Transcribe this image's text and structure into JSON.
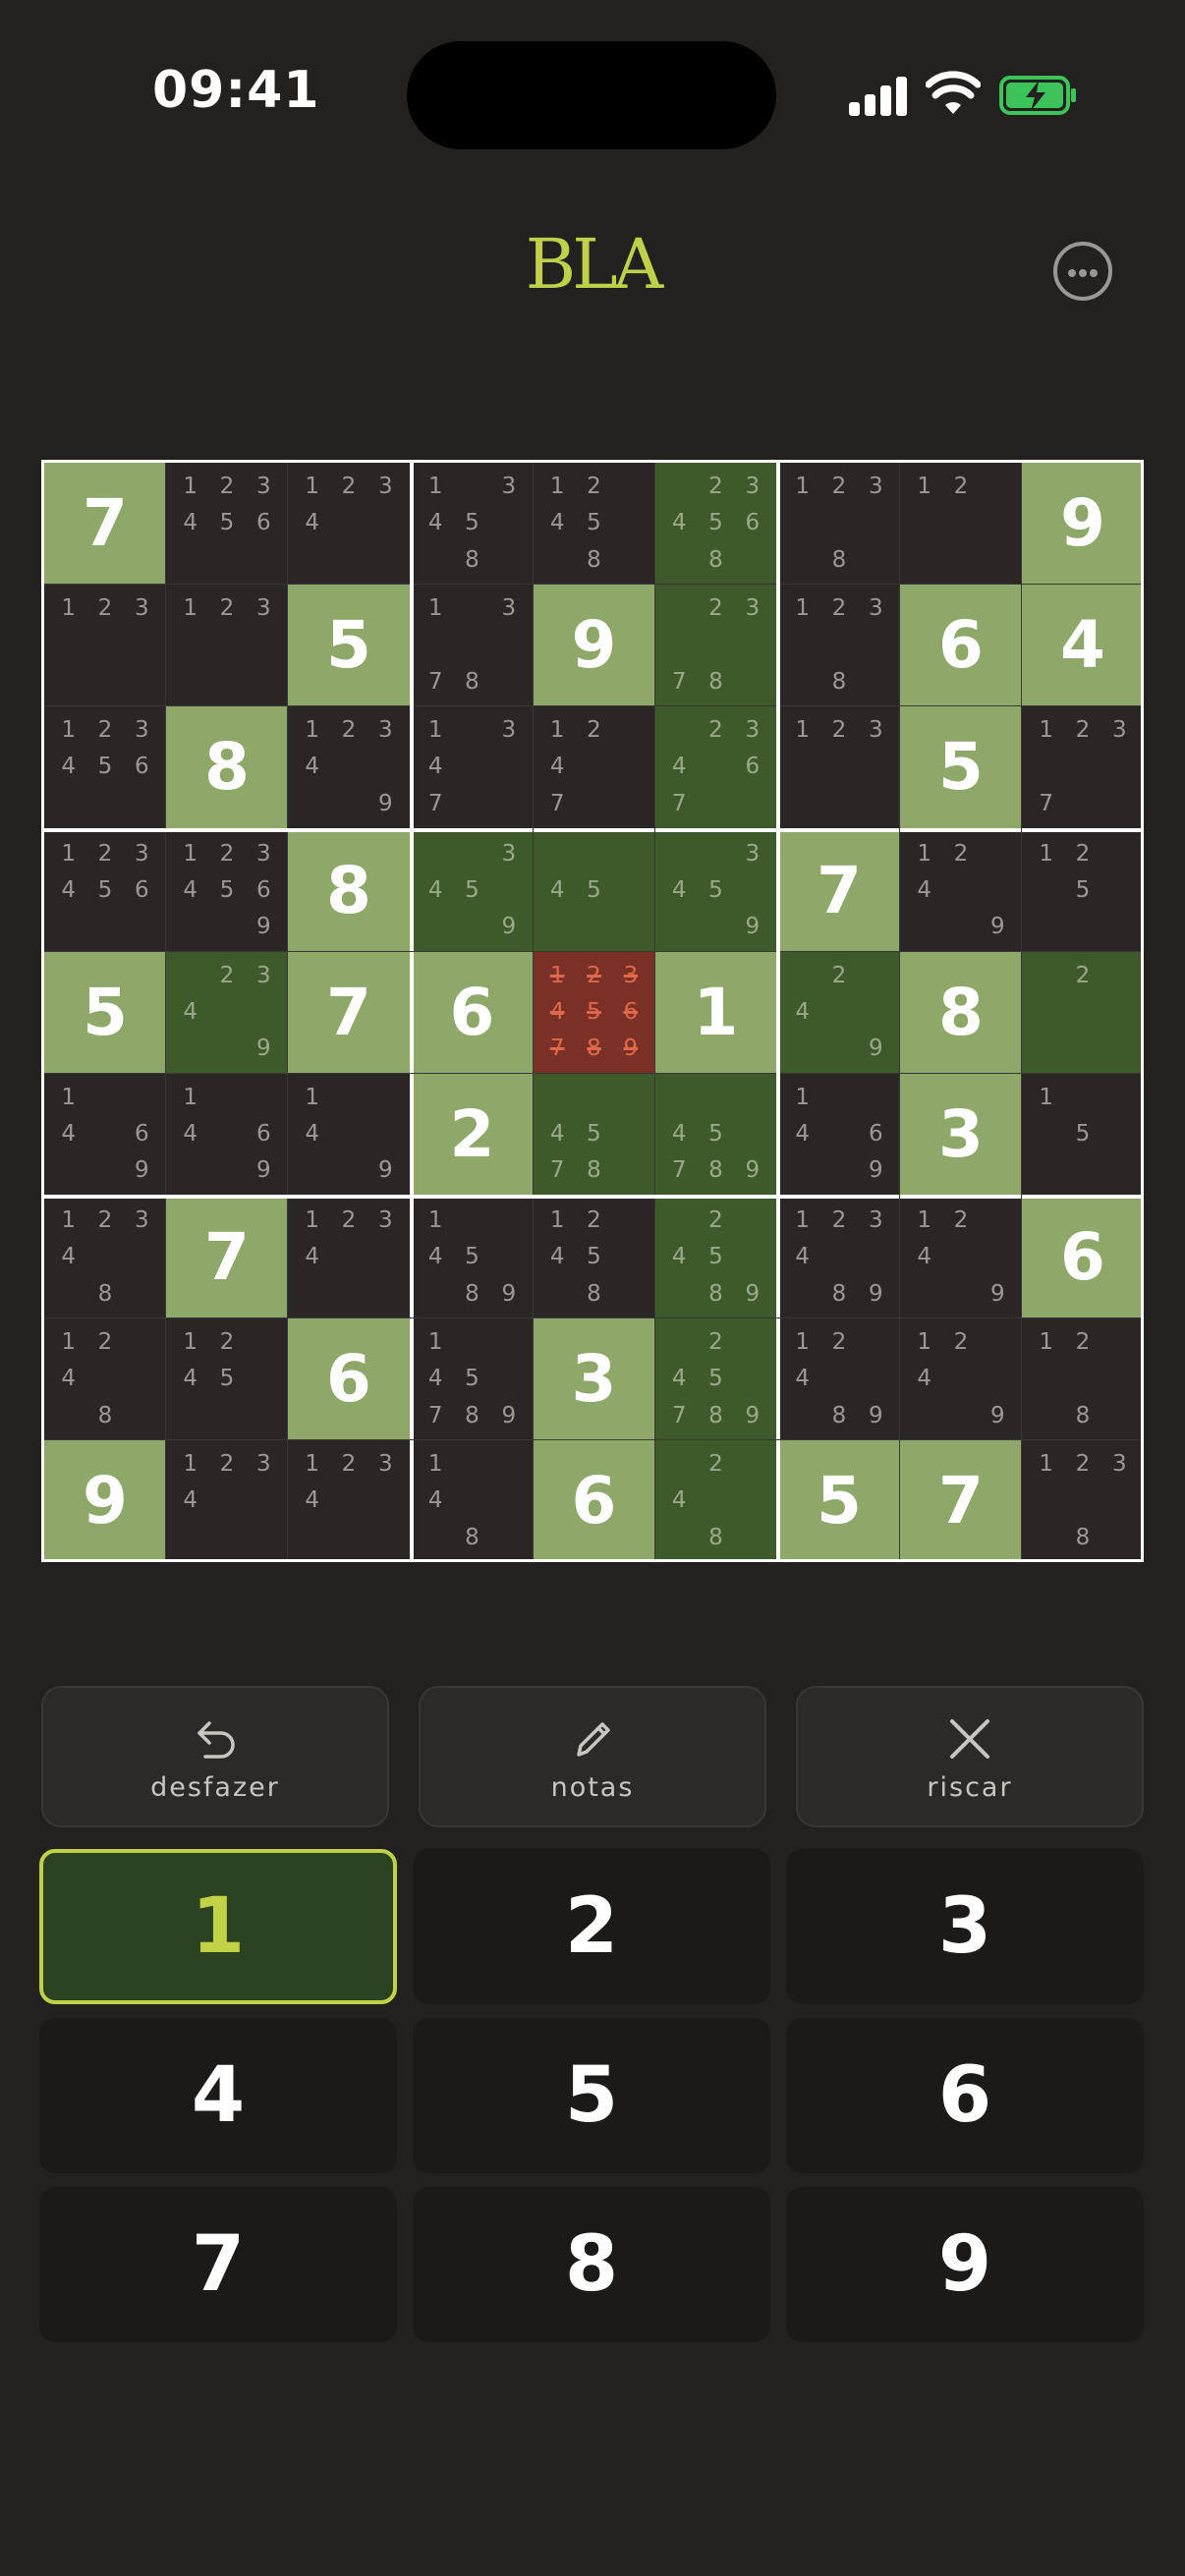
{
  "status_bar": {
    "time": "09:41"
  },
  "header": {
    "logo": "BLA",
    "menu_icon": "more-horizontal-icon"
  },
  "board": {
    "cells": [
      [
        {
          "v": "7",
          "bg": "given"
        },
        {
          "n": "123456",
          "bg": "dark"
        },
        {
          "n": "1234",
          "bg": "dark"
        },
        {
          "n": "13458",
          "bg": "dark"
        },
        {
          "n": "12458",
          "bg": "dark"
        },
        {
          "n": "234568",
          "bg": "hl"
        },
        {
          "n": "1238",
          "bg": "dark"
        },
        {
          "n": "12",
          "bg": "dark"
        },
        {
          "v": "9",
          "bg": "given"
        }
      ],
      [
        {
          "n": "123",
          "bg": "dark"
        },
        {
          "n": "123",
          "bg": "dark"
        },
        {
          "v": "5",
          "bg": "given"
        },
        {
          "n": "1378",
          "bg": "dark"
        },
        {
          "v": "9",
          "bg": "given"
        },
        {
          "n": "2378",
          "bg": "hl"
        },
        {
          "n": "1238",
          "bg": "dark"
        },
        {
          "v": "6",
          "bg": "given"
        },
        {
          "v": "4",
          "bg": "given"
        }
      ],
      [
        {
          "n": "123456",
          "bg": "dark"
        },
        {
          "v": "8",
          "bg": "given"
        },
        {
          "n": "12349",
          "bg": "dark"
        },
        {
          "n": "1347",
          "bg": "dark"
        },
        {
          "n": "1247",
          "bg": "dark"
        },
        {
          "n": "23467",
          "bg": "hl"
        },
        {
          "n": "123",
          "bg": "dark"
        },
        {
          "v": "5",
          "bg": "given"
        },
        {
          "n": "1237",
          "bg": "dark"
        }
      ],
      [
        {
          "n": "123456",
          "bg": "dark"
        },
        {
          "n": "1234569",
          "bg": "dark"
        },
        {
          "v": "8",
          "bg": "given"
        },
        {
          "n": "3459",
          "bg": "hl"
        },
        {
          "n": "45",
          "bg": "hl"
        },
        {
          "n": "3459",
          "bg": "hl"
        },
        {
          "v": "7",
          "bg": "given"
        },
        {
          "n": "1249",
          "bg": "dark"
        },
        {
          "n": "125",
          "bg": "dark"
        }
      ],
      [
        {
          "v": "5",
          "bg": "given"
        },
        {
          "n": "2349",
          "bg": "hl"
        },
        {
          "v": "7",
          "bg": "given"
        },
        {
          "v": "6",
          "bg": "given"
        },
        {
          "n": "123456789",
          "bg": "sel"
        },
        {
          "v": "1",
          "bg": "given"
        },
        {
          "n": "249",
          "bg": "hl"
        },
        {
          "v": "8",
          "bg": "given"
        },
        {
          "n": "2",
          "bg": "hl"
        }
      ],
      [
        {
          "n": "1469",
          "bg": "dark"
        },
        {
          "n": "14469",
          "bg": "dark"
        },
        {
          "n": "149",
          "bg": "dark"
        },
        {
          "v": "2",
          "bg": "given"
        },
        {
          "n": "4578",
          "bg": "hl"
        },
        {
          "n": "45789",
          "bg": "hl"
        },
        {
          "n": "1469",
          "bg": "dark"
        },
        {
          "v": "3",
          "bg": "given"
        },
        {
          "n": "15",
          "bg": "dark"
        }
      ],
      [
        {
          "n": "12348",
          "bg": "dark"
        },
        {
          "v": "7",
          "bg": "given"
        },
        {
          "n": "1234",
          "bg": "dark"
        },
        {
          "n": "14589",
          "bg": "dark"
        },
        {
          "n": "12458",
          "bg": "dark"
        },
        {
          "n": "24589",
          "bg": "hl"
        },
        {
          "n": "123489",
          "bg": "dark"
        },
        {
          "n": "1249",
          "bg": "dark"
        },
        {
          "v": "6",
          "bg": "given"
        }
      ],
      [
        {
          "n": "1248",
          "bg": "dark"
        },
        {
          "n": "1245",
          "bg": "dark"
        },
        {
          "v": "6",
          "bg": "given"
        },
        {
          "n": "145789",
          "bg": "dark"
        },
        {
          "v": "3",
          "bg": "given"
        },
        {
          "n": "245789",
          "bg": "hl"
        },
        {
          "n": "12489",
          "bg": "dark"
        },
        {
          "n": "1249",
          "bg": "dark"
        },
        {
          "n": "128",
          "bg": "dark"
        }
      ],
      [
        {
          "v": "9",
          "bg": "given"
        },
        {
          "n": "1234",
          "bg": "dark"
        },
        {
          "n": "1234",
          "bg": "dark"
        },
        {
          "n": "148",
          "bg": "dark"
        },
        {
          "v": "6",
          "bg": "given"
        },
        {
          "n": "248",
          "bg": "hl"
        },
        {
          "v": "5",
          "bg": "given"
        },
        {
          "v": "7",
          "bg": "given"
        },
        {
          "n": "1238",
          "bg": "dark"
        }
      ]
    ]
  },
  "actions": [
    {
      "label": "desfazer",
      "icon": "undo-icon"
    },
    {
      "label": "notas",
      "icon": "pencil-icon"
    },
    {
      "label": "riscar",
      "icon": "close-icon"
    }
  ],
  "keypad": {
    "keys": [
      "1",
      "2",
      "3",
      "4",
      "5",
      "6",
      "7",
      "8",
      "9"
    ],
    "selected": "1"
  },
  "colors": {
    "accent": "#c1d247",
    "given_cell": "#8ea86a",
    "highlight_cell": "#3f5a2a",
    "selected_cell": "#7a3025",
    "background": "#232120"
  }
}
